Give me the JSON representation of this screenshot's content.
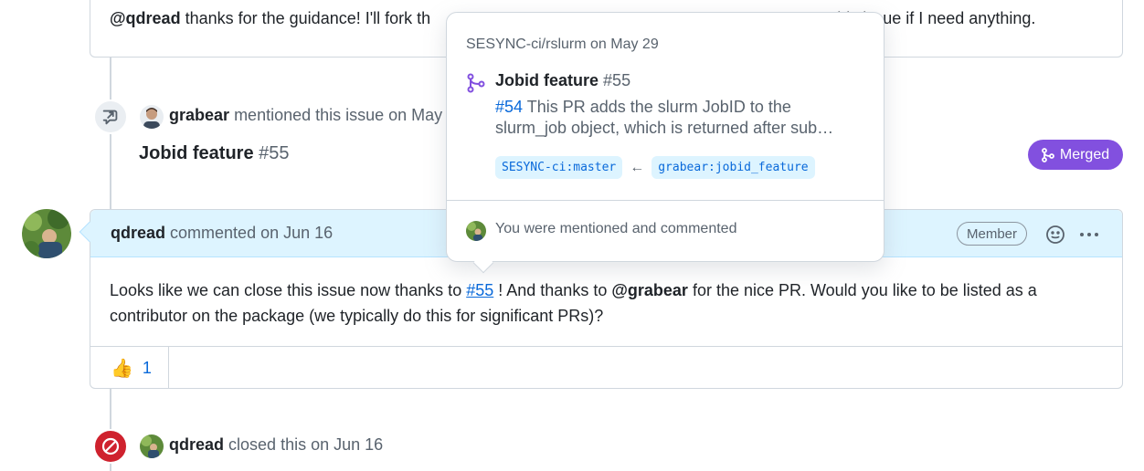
{
  "top_comment": {
    "author": "@qdread",
    "text_left": "thanks for the guidance! I'll fork th",
    "text_right": "this issue if I need anything."
  },
  "reference_event": {
    "actor": "grabear",
    "action": "mentioned this issue on May",
    "linked_title": "Jobid feature",
    "linked_number": "#55",
    "state_label": "Merged"
  },
  "main_comment": {
    "author": "qdread",
    "meta": "commented on Jun 16",
    "role_badge": "Member",
    "body": {
      "part1": "Looks like we can close this issue now thanks to ",
      "link": "#55",
      "part2": " ! And thanks to ",
      "mention": "@grabear",
      "part3": " for the nice PR. Would you like to be listed as a contributor on the package (we typically do this for significant PRs)?"
    },
    "reactions": [
      {
        "emoji": "👍",
        "count": "1"
      }
    ]
  },
  "closed_event": {
    "actor": "qdread",
    "action": "closed this on Jun 16"
  },
  "hovercard": {
    "repo": "SESYNC-ci/rslurm",
    "date": "on May 29",
    "title": "Jobid feature",
    "number": "#55",
    "desc_ref": "#54",
    "desc_text": " This PR adds the slurm JobID to the slurm_job object, which is returned after sub…",
    "base_branch": "SESYNC-ci:master",
    "arrow": "←",
    "head_branch": "grabear:jobid_feature",
    "footer": "You were mentioned and commented"
  },
  "colors": {
    "merged": "#8250df",
    "closed": "#cf222e",
    "link": "#0969da",
    "header_bg": "#ddf4ff"
  },
  "icons": {
    "reference": "cross-reference-icon",
    "merge": "git-merge-icon",
    "closed": "circle-slash-icon",
    "emoji": "smiley-icon",
    "more": "kebab-horizontal-icon"
  }
}
